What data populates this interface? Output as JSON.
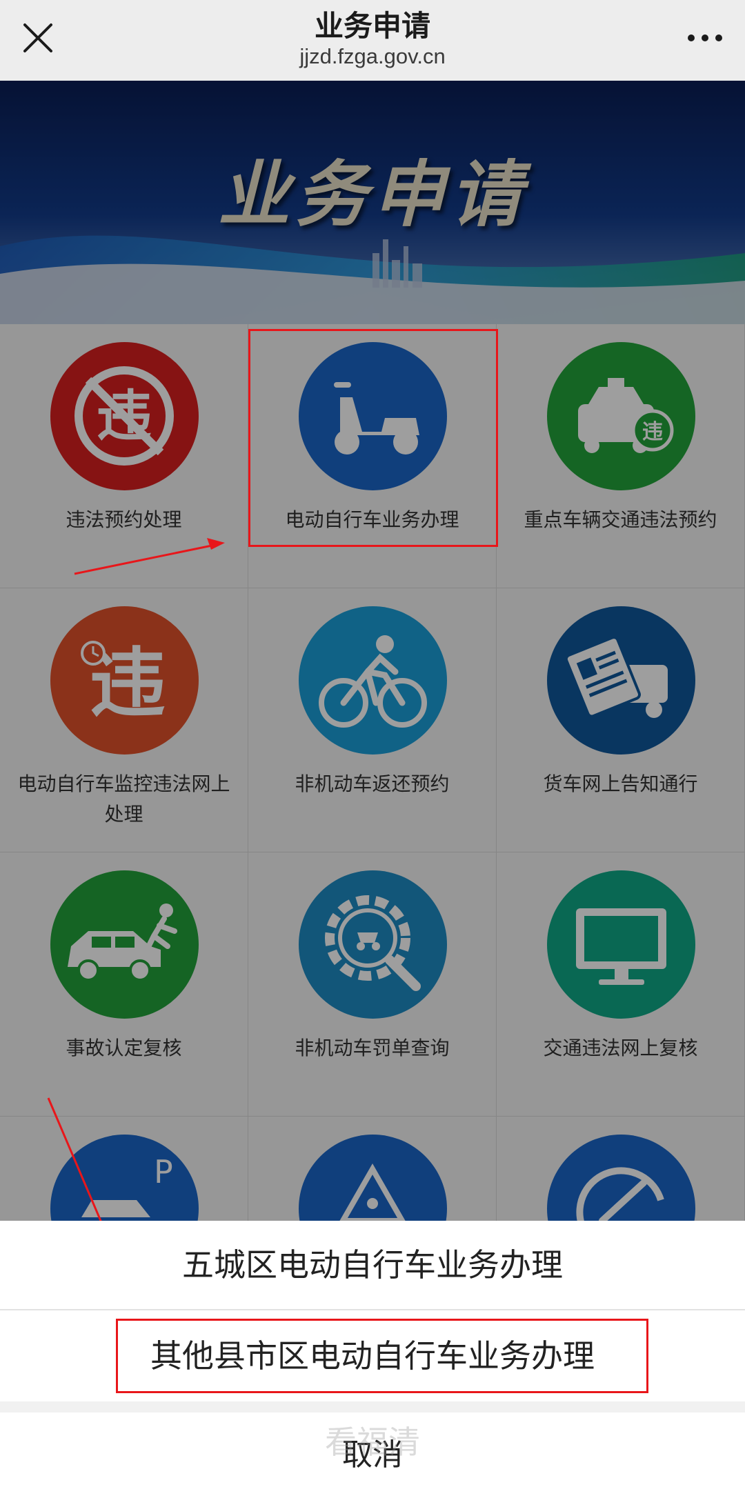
{
  "topbar": {
    "title": "业务申请",
    "url": "jjzd.fzga.gov.cn",
    "close_icon": "close-icon",
    "more_icon": "more-dots-icon"
  },
  "banner": {
    "title": "业务申请"
  },
  "grid": {
    "items": [
      {
        "label": "违法预约处理",
        "icon": "violation-stamp-icon",
        "color": "#d9201f"
      },
      {
        "label": "电动自行车业务办理",
        "icon": "electric-scooter-icon",
        "color": "#1a67c9"
      },
      {
        "label": "重点车辆交通违法预约",
        "icon": "taxi-violation-icon",
        "color": "#23a43a"
      },
      {
        "label": "电动自行车监控违法网上处理",
        "icon": "violation-clock-icon",
        "color": "#e0522b"
      },
      {
        "label": "非机动车返还预约",
        "icon": "bicycle-rider-icon",
        "color": "#1b9fd8"
      },
      {
        "label": "货车网上告知通行",
        "icon": "truck-document-icon",
        "color": "#10589c"
      },
      {
        "label": "事故认定复核",
        "icon": "car-accident-icon",
        "color": "#22a23b"
      },
      {
        "label": "非机动车罚单查询",
        "icon": "gear-magnifier-icon",
        "color": "#1e8bc3"
      },
      {
        "label": "交通违法网上复核",
        "icon": "monitor-icon",
        "color": "#0fa887"
      },
      {
        "label": "",
        "icon": "parking-car-icon",
        "color": "#1a67c9"
      },
      {
        "label": "",
        "icon": "road-work-sign-icon",
        "color": "#1a67c9"
      },
      {
        "label": "",
        "icon": "speedometer-icon",
        "color": "#1a67c9"
      }
    ]
  },
  "sheet": {
    "option1": "五城区电动自行车业务办理",
    "option2": "其他县市区电动自行车业务办理",
    "cancel": "取消"
  },
  "watermark": "看福清",
  "colors": {
    "highlight": "#e8161a",
    "overlay": "rgba(0,0,0,0.38)"
  }
}
